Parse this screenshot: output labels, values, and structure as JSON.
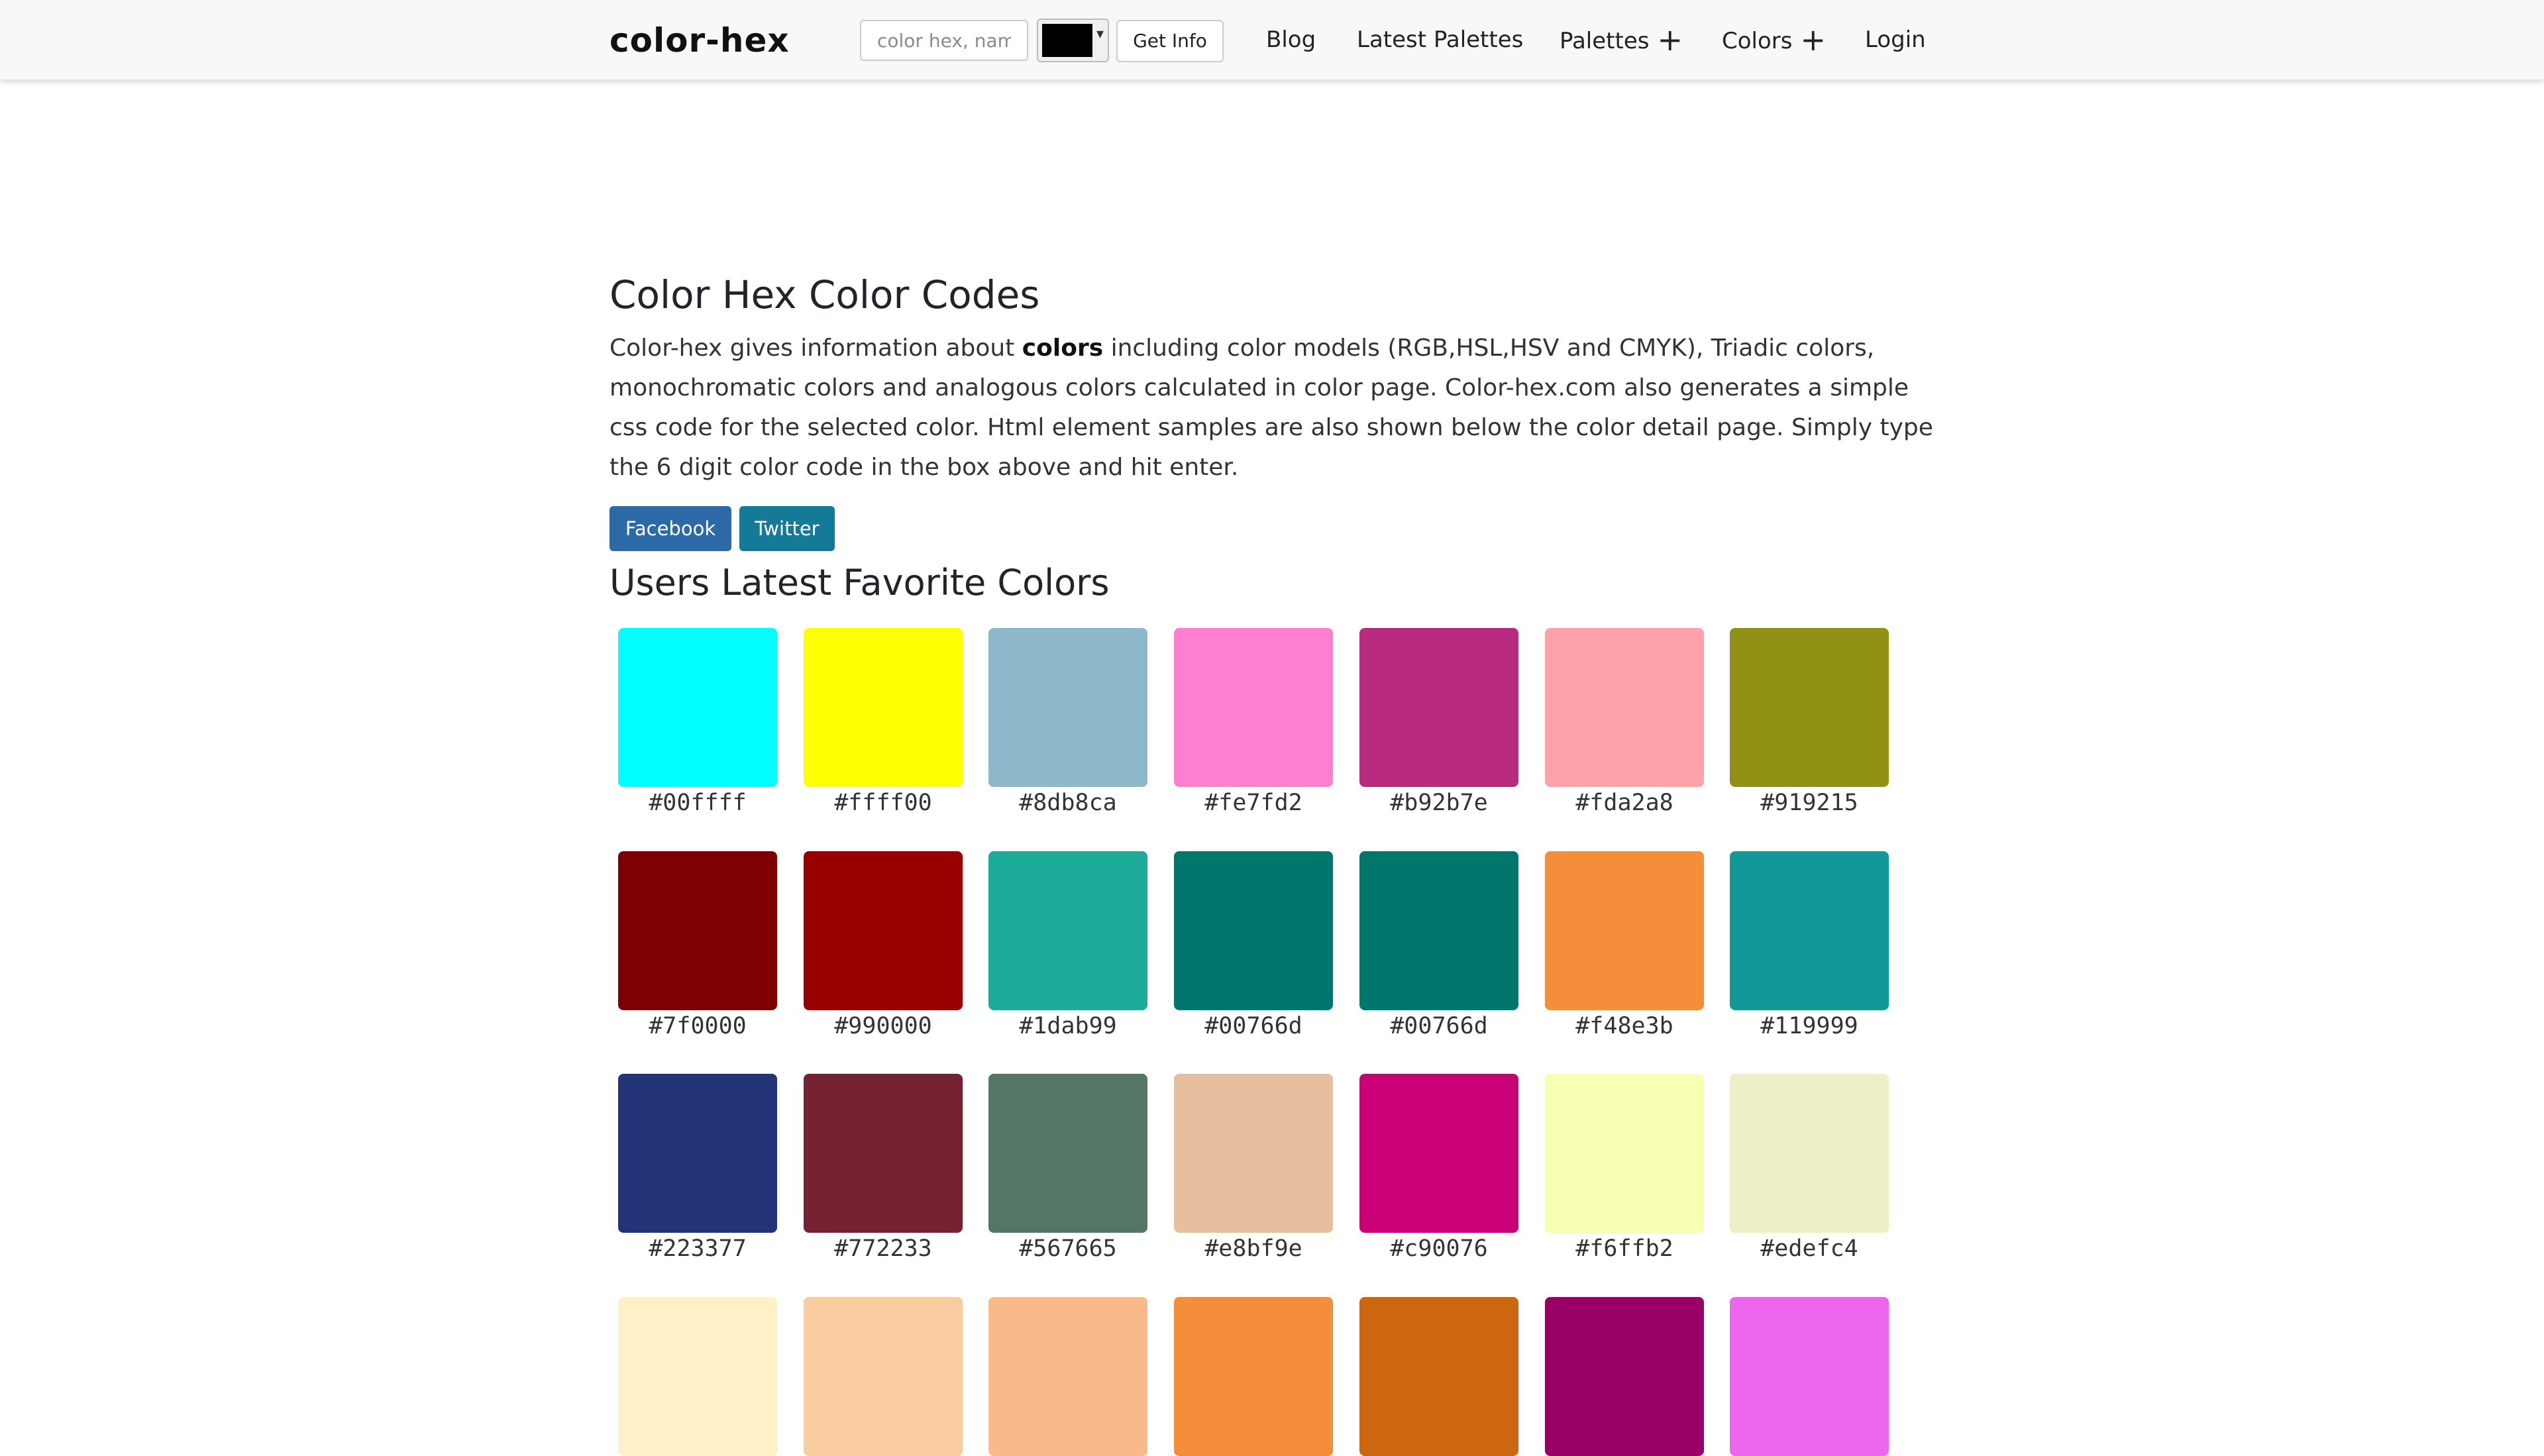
{
  "header": {
    "logo": "color-hex",
    "search_placeholder": "color hex, name",
    "picker_color": "#000000",
    "get_info_label": "Get Info",
    "nav": [
      {
        "label": "Blog",
        "has_plus": false
      },
      {
        "label": "Latest Palettes",
        "has_plus": false
      },
      {
        "label": "Palettes",
        "has_plus": true
      },
      {
        "label": "Colors",
        "has_plus": true
      },
      {
        "label": "Login",
        "has_plus": false
      }
    ]
  },
  "main": {
    "title": "Color Hex Color Codes",
    "intro_before": "Color-hex gives information about ",
    "intro_bold": "colors",
    "intro_after": " including color models (RGB,HSL,HSV and CMYK), Triadic colors, monochromatic colors and analogous colors calculated in color page. Color-hex.com also generates a simple css code for the selected color. Html element samples are also shown below the color detail page. Simply type the 6 digit color code in the box above and hit enter.",
    "share": {
      "facebook": "Facebook",
      "twitter": "Twitter"
    },
    "section_title": "Users Latest Favorite Colors"
  },
  "colors": {
    "facebook_btn": "#2b6aa6",
    "twitter_btn": "#157a98"
  },
  "favorites": [
    "#00ffff",
    "#ffff00",
    "#8db8ca",
    "#fe7fd2",
    "#b92b7e",
    "#fda2a8",
    "#919215",
    "#7f0000",
    "#990000",
    "#1dab99",
    "#00766d",
    "#00766d",
    "#f48e3b",
    "#119999",
    "#223377",
    "#772233",
    "#567665",
    "#e8bf9e",
    "#c90076",
    "#f6ffb2",
    "#edefc4"
  ],
  "favorites_partial_row": [
    "#fff0c8",
    "#f8cc9e",
    "#f8ba8a",
    "#f48e3b",
    "#cc6611",
    "#990066",
    "#ee66ee"
  ]
}
